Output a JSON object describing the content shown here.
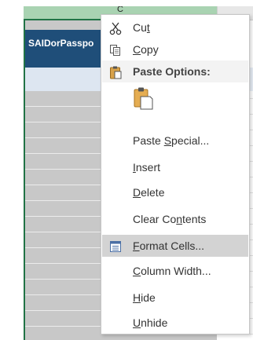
{
  "sheet": {
    "column_letter": "C",
    "header_cell_text": "SAIDorPasspo"
  },
  "context_menu": {
    "cut": {
      "label_pre": "Cu",
      "accel": "t",
      "label_post": "",
      "icon": "scissors-icon"
    },
    "copy": {
      "label_pre": "",
      "accel": "C",
      "label_post": "opy",
      "icon": "copy-icon"
    },
    "paste_options": {
      "label": "Paste Options:",
      "icon": "clipboard-icon"
    },
    "paste_button": {
      "icon": "clipboard-paste-icon"
    },
    "paste_special": {
      "label_pre": "Paste ",
      "accel": "S",
      "label_post": "pecial..."
    },
    "insert": {
      "label_pre": "",
      "accel": "I",
      "label_post": "nsert"
    },
    "delete": {
      "label_pre": "",
      "accel": "D",
      "label_post": "elete"
    },
    "clear_contents": {
      "label_pre": "Clear Co",
      "accel": "n",
      "label_post": "tents"
    },
    "format_cells": {
      "label_pre": "",
      "accel": "F",
      "label_post": "ormat Cells...",
      "icon": "format-cells-icon",
      "highlighted": true
    },
    "column_width": {
      "label_pre": "",
      "accel": "C",
      "label_post": "olumn Width..."
    },
    "hide": {
      "label_pre": "",
      "accel": "H",
      "label_post": "ide"
    },
    "unhide": {
      "label_pre": "",
      "accel": "U",
      "label_post": "nhide"
    }
  },
  "colors": {
    "accent_green": "#217346",
    "header_fill": "#1f4e79",
    "highlight": "#d3d3d3"
  }
}
